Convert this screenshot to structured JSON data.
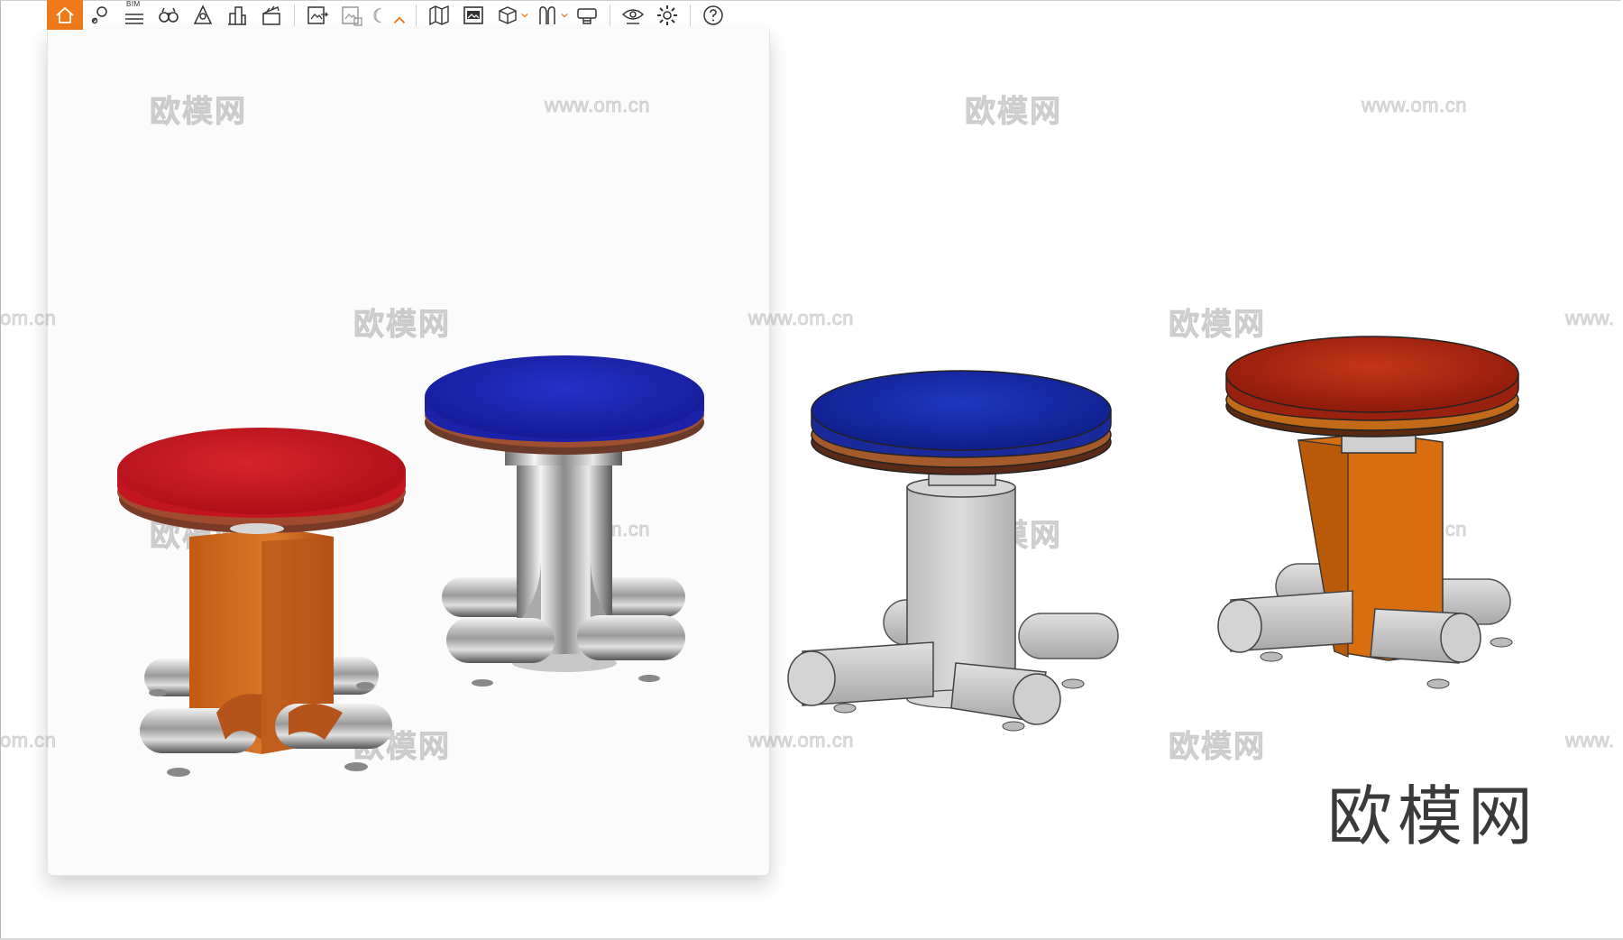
{
  "toolbar": {
    "items": [
      {
        "name": "home-icon",
        "active": true
      },
      {
        "name": "location-pin-icon"
      },
      {
        "name": "bim-menu-icon",
        "label": "BIM"
      },
      {
        "name": "binoculars-icon"
      },
      {
        "name": "compass-tool-icon"
      },
      {
        "name": "buildings-icon"
      },
      {
        "name": "clapperboard-icon"
      },
      {
        "name": "export-image-icon"
      },
      {
        "name": "batch-render-icon"
      },
      {
        "name": "moon-icon"
      },
      {
        "name": "collapse-chevron-icon"
      },
      {
        "name": "map-icon"
      },
      {
        "name": "panorama-icon"
      },
      {
        "name": "cube-icon"
      },
      {
        "name": "figure-icon"
      },
      {
        "name": "vr-headset-icon"
      },
      {
        "name": "eye-visibility-icon"
      },
      {
        "name": "settings-gear-icon"
      },
      {
        "name": "help-icon"
      }
    ],
    "accent_color": "#f07a1a"
  },
  "watermarks": {
    "site_cn": "欧模网",
    "site_url": "www.om.cn",
    "partial_url_left": "om.cn",
    "partial_url_right": "www."
  },
  "brand": {
    "logo_text": "欧模网"
  },
  "objects": {
    "rendered_stools": [
      {
        "seat_color": "#c4141f",
        "base": "orange-wood-column"
      },
      {
        "seat_color": "#1b22b0",
        "base": "chrome-cylinder"
      }
    ],
    "sketch_stools": [
      {
        "seat_color": "#1a2aa8",
        "base": "grey-cylinder"
      },
      {
        "seat_color": "#b02010",
        "base": "orange-column"
      }
    ]
  }
}
